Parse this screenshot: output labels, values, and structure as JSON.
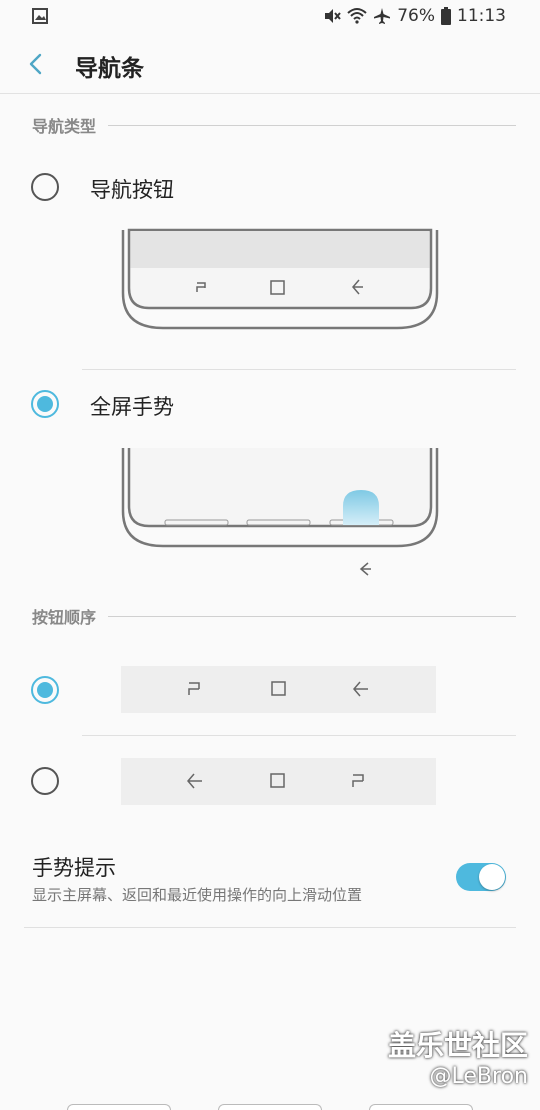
{
  "status_bar": {
    "battery": "76%",
    "time": "11:13",
    "icons": [
      "gallery-icon",
      "mute-icon",
      "wifi-icon",
      "airplane-icon",
      "battery-icon"
    ]
  },
  "header": {
    "title": "导航条"
  },
  "nav_type": {
    "section_label": "导航类型",
    "options": [
      {
        "label": "导航按钮",
        "selected": false
      },
      {
        "label": "全屏手势",
        "selected": true
      }
    ]
  },
  "button_order": {
    "section_label": "按钮顺序",
    "options": [
      {
        "order": [
          "recents-icon",
          "home-icon",
          "back-icon"
        ],
        "selected": true
      },
      {
        "order": [
          "back-icon",
          "home-icon",
          "recents-icon"
        ],
        "selected": false
      }
    ]
  },
  "gesture_hint": {
    "title": "手势提示",
    "description": "显示主屏幕、返回和最近使用操作的向上滑动位置",
    "enabled": true
  },
  "watermark": {
    "title": "盖乐世社区",
    "user": "@LeBron"
  },
  "colors": {
    "accent": "#4eb9de",
    "background": "#fafafa"
  }
}
